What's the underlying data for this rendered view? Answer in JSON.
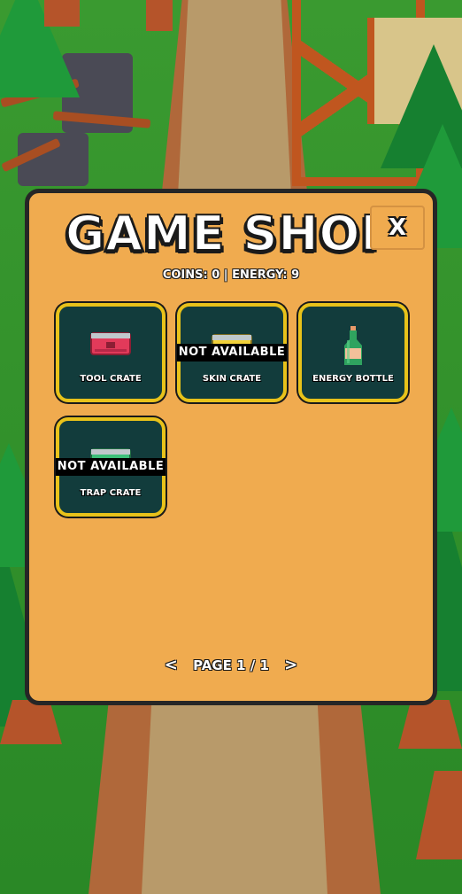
{
  "shop": {
    "title": "GAME SHOP",
    "close_label": "X",
    "stats": "COINS: 0 | ENERGY: 9",
    "items": [
      {
        "label": "TOOL CRATE",
        "icon": "tool-crate-icon",
        "available": true,
        "color": "#e23a5a"
      },
      {
        "label": "SKIN CRATE",
        "icon": "skin-crate-icon",
        "available": false,
        "banner": "NOT AVAILABLE",
        "color": "#f1d13a"
      },
      {
        "label": "ENERGY BOTTLE",
        "icon": "energy-bottle-icon",
        "available": true,
        "color": "#2fa35f"
      },
      {
        "label": "TRAP CRATE",
        "icon": "trap-crate-icon",
        "available": false,
        "banner": "NOT AVAILABLE",
        "color": "#3ec07a"
      }
    ],
    "pager": {
      "prev": "<",
      "label": "PAGE 1 / 1",
      "next": ">"
    }
  },
  "colors": {
    "panel": "#f0ab4f",
    "card_bg": "#123c3c",
    "card_border": "#e8c21a"
  }
}
